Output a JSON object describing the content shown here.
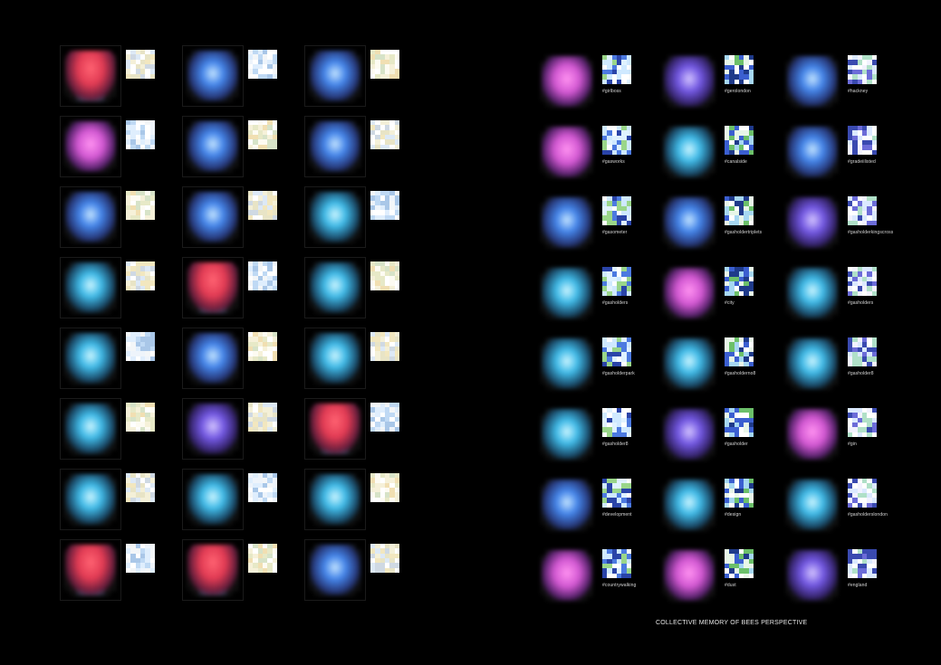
{
  "caption": "COLLECTIVE MEMORY OF BEES PERSPECTIVE",
  "left_panel": {
    "palettes": [
      "warm-red",
      "pink",
      "blue",
      "blue",
      "red",
      "cyan",
      "blue",
      "blue",
      "cyan",
      "red",
      "pink",
      "cyan"
    ]
  },
  "right_panel": {
    "tags": [
      [
        "#girlboss",
        "#gerolondon",
        "#hackney"
      ],
      [
        "#gasworks",
        "#canalside",
        "#gradeiilisted"
      ],
      [
        "#gasometer",
        "#gasholdertriplets",
        "#gasholderkingscross"
      ],
      [
        "#gasholders",
        "#city",
        "#gasholders"
      ],
      [
        "#gasholderpark",
        "#gasholderno8",
        "#gasholder8"
      ],
      [
        "#gasholder8",
        "#gasholder",
        "#gin"
      ],
      [
        "#development",
        "#design",
        "#gasholderslondon"
      ],
      [
        "#countrywalking",
        "#dust",
        "#england"
      ]
    ]
  },
  "colors": {
    "background": "#000000",
    "red": "#e0304a",
    "pink": "#d04fd0",
    "blue": "#3a7ee8",
    "cyan": "#35b6e6",
    "violet": "#6a4ee0"
  }
}
